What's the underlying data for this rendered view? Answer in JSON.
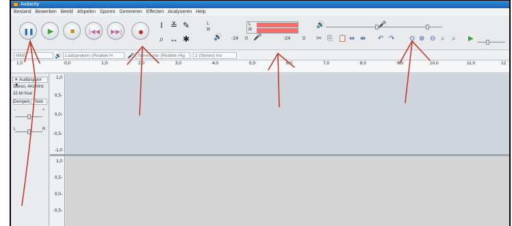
{
  "window": {
    "title": "Audacity"
  },
  "menu": [
    "Bestand",
    "Bewerken",
    "Beeld",
    "Afspelen",
    "Sporen",
    "Genereren",
    "Effecten",
    "Analyseren",
    "Help"
  ],
  "transport": {
    "pause_icon": "pause-icon",
    "play_icon": "play-icon",
    "stop_icon": "stop-icon",
    "skip_start_icon": "skip-to-start-icon",
    "skip_end_icon": "skip-to-end-icon",
    "record_icon": "record-icon"
  },
  "meter": {
    "left_label": "L",
    "right_label": "R",
    "db_left": "-24",
    "db_right": "-24",
    "zero_left": "0",
    "zero_right": "0"
  },
  "device": {
    "host": "MME",
    "output": "Luidsprekers (Realtek H",
    "input": "Stereo-mix (Realtek Hig",
    "channels": "2 (Stereo) inv"
  },
  "ruler": {
    "ticks": [
      "1,0",
      "0,0",
      "1,0",
      "2,0",
      "3,0",
      "4,0",
      "5,0",
      "6,0",
      "7,0",
      "8,0",
      "9,0",
      "10,0",
      "11,0",
      "12"
    ]
  },
  "track": {
    "name": "Audiospoor",
    "rate": "Stereo, 44100Hz",
    "format": "32-bit float",
    "mute": "Dempen",
    "solo": "Solo",
    "gain_minus": "-",
    "gain_plus": "+",
    "pan_left": "L",
    "pan_right": "R",
    "scale_top": [
      "1,0",
      "0,5-",
      "0,0-",
      "-0,5-",
      "-1,0"
    ],
    "scale_bottom": [
      "1,0",
      "0,5-",
      "0,0-",
      "-0,5-"
    ]
  },
  "colors": {
    "annotation": "#c0392b",
    "meter_red": "#ef6d6d"
  }
}
